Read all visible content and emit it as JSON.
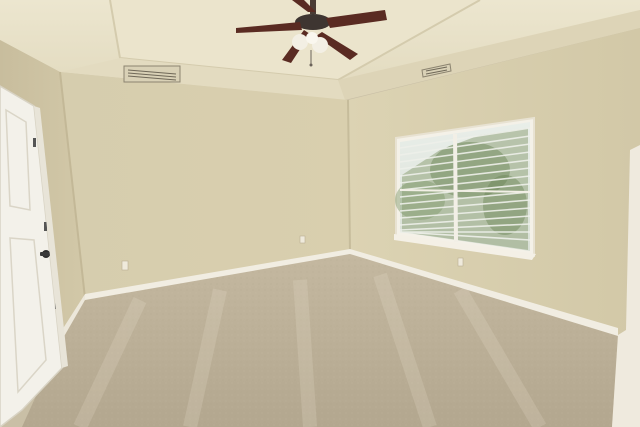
{
  "scene": {
    "subject": "empty-bedroom",
    "elements": [
      "ceiling-fan",
      "tray-ceiling",
      "window-with-blinds",
      "interior-door",
      "carpet-floor",
      "hvac-vent",
      "baseboard"
    ],
    "colors": {
      "wall_warm": "#ddd4b4",
      "wall_shadow": "#cfc5a3",
      "ceiling": "#e8e1c8",
      "carpet": "#bfb39c",
      "trim": "#f4f0e6",
      "door": "#f3f1ea",
      "fan_blade": "#5a2b22",
      "window_foliage": "#7f9a68"
    }
  }
}
